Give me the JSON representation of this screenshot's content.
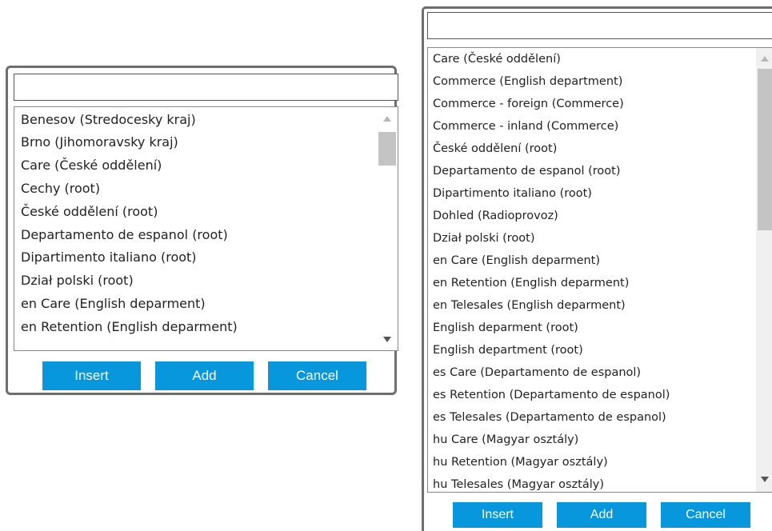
{
  "left_dialog": {
    "search": {
      "value": "",
      "placeholder": ""
    },
    "items": [
      "Benesov (Stredocesky kraj)",
      "Brno (Jihomoravsky kraj)",
      "Care (České oddělení)",
      "Cechy (root)",
      "České oddělení (root)",
      "Departamento de espanol (root)",
      "Dipartimento italiano (root)",
      "Dział polski (root)",
      "en Care (English deparment)",
      "en Retention (English deparment)"
    ],
    "buttons": {
      "insert": "Insert",
      "add": "Add",
      "cancel": "Cancel"
    }
  },
  "right_dialog": {
    "search": {
      "value": "",
      "placeholder": ""
    },
    "items": [
      "Care (České oddělení)",
      "Commerce (English department)",
      "Commerce - foreign (Commerce)",
      "Commerce - inland (Commerce)",
      "České oddělení (root)",
      "Departamento de espanol (root)",
      "Dipartimento italiano (root)",
      "Dohled (Radioprovoz)",
      "Dział polski (root)",
      "en Care (English deparment)",
      "en Retention (English deparment)",
      "en Telesales (English deparment)",
      "English deparment (root)",
      "English department (root)",
      "es Care (Departamento de espanol)",
      "es Retention (Departamento de espanol)",
      "es Telesales (Departamento de espanol)",
      "hu Care (Magyar osztály)",
      "hu Retention (Magyar osztály)",
      "hu Telesales (Magyar osztály)"
    ],
    "buttons": {
      "insert": "Insert",
      "add": "Add",
      "cancel": "Cancel"
    }
  },
  "colors": {
    "button_bg": "#0797dd",
    "button_text": "#ffffff",
    "dialog_border": "#6e6e6e"
  },
  "icons": [
    "scroll-up-arrow-icon",
    "scroll-down-arrow-icon"
  ]
}
